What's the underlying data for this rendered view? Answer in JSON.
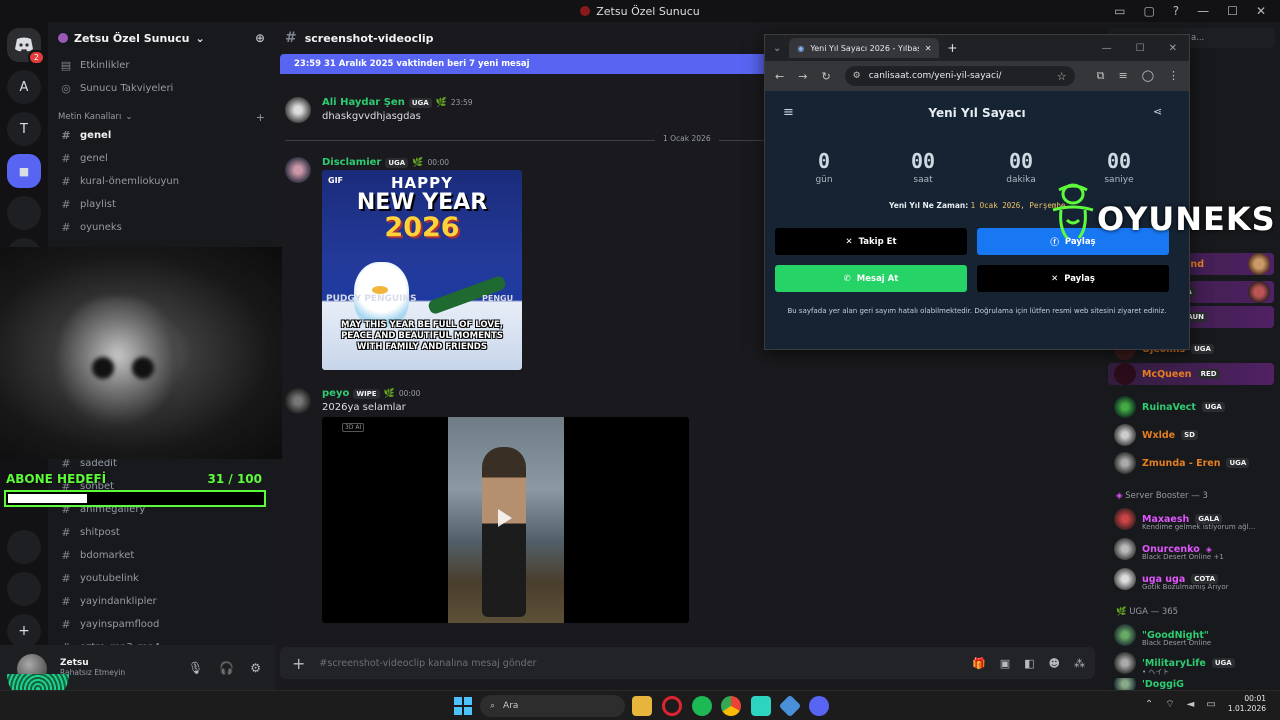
{
  "window": {
    "title": "Zetsu Özel Sunucu",
    "controls": [
      "▭",
      "▢",
      "?",
      "—",
      "☐",
      "✕"
    ]
  },
  "server": {
    "name": "Zetsu Özel Sunucu",
    "chevron": "⌄",
    "add_member_icon": "person-add-icon"
  },
  "rail": {
    "badge": "2",
    "letters": [
      "A",
      "T"
    ]
  },
  "sidebar": {
    "top_items": [
      {
        "label": "Etkinlikler",
        "icon": "▤"
      },
      {
        "label": "Sunucu Takviyeleri",
        "icon": "◎"
      }
    ],
    "category": "Metin Kanalları",
    "channels": [
      "genel",
      "genel",
      "kural-önemliokuyun",
      "playlist",
      "oyuneks"
    ],
    "lower_channels": [
      "sadedit",
      "sohbet",
      "animegallery",
      "shitpost",
      "bdomarket",
      "youtubelink",
      "yayindanklipler",
      "yayinspamflood",
      "oztro_mp3_mp4"
    ]
  },
  "overlay": {
    "goal_label": "ABONE HEDEFİ",
    "goal_current": 31,
    "goal_total": 100,
    "goal_sep": "/"
  },
  "user": {
    "name": "Zetsu",
    "status": "Rahatsız Etmeyin"
  },
  "chat": {
    "channel": "screenshot-videoclip",
    "new_messages": "23:59 31 Aralık 2025 vaktinden beri 7 yeni mesaj",
    "date_divider": "1 Ocak 2026",
    "messages": [
      {
        "user": "Ali Haydar Şen",
        "tag": "UGA",
        "time": "23:59",
        "text": "dhaskgvvdhjasgdas",
        "color": "#2ecc71"
      },
      {
        "user": "Disclamier",
        "tag": "UGA",
        "time": "00:00",
        "text": "",
        "color": "#2ecc71"
      },
      {
        "user": "peyo",
        "tag": "WIPE",
        "time": "00:00",
        "text": "2026ya selamlar",
        "color": "#2ecc71"
      }
    ],
    "gif": {
      "label": "GIF",
      "line1": "HAPPY",
      "line2": "NEW YEAR",
      "line3": "2026",
      "brand_left": "PUDGY PENGUINS",
      "brand_right": "PENGU",
      "caption": "MAY THIS YEAR BE FULL OF LOVE, PEACE AND BEAUTIFUL MOMENTS WITH FAMILY AND FRIENDS"
    },
    "video_tag": "3D AI",
    "composer_placeholder": "#screenshot-videoclip kanalına mesaj gönder"
  },
  "members": {
    "search_placeholder": "sunucusunu a...",
    "list": [
      {
        "name": "mond",
        "color": "#e67e22",
        "tag": "",
        "sub": ""
      },
      {
        "name": "",
        "color": "#9b59b6",
        "tag": "UGA",
        "sub": ""
      },
      {
        "name": "ga",
        "color": "#e67e22",
        "tag": "ZAUN",
        "sub": ""
      },
      {
        "name": "Ojeomis",
        "color": "#e67e22",
        "tag": "UGA",
        "sub": ""
      },
      {
        "name": "McQueen",
        "color": "#e67e22",
        "tag": "RED",
        "sub": ""
      },
      {
        "name": "RuinaVect",
        "color": "#2ecc71",
        "tag": "UGA",
        "sub": ""
      },
      {
        "name": "Wxlde",
        "color": "#e67e22",
        "tag": "SD",
        "sub": ""
      },
      {
        "name": "Zmunda - Eren",
        "color": "#e67e22",
        "tag": "UGA",
        "sub": ""
      }
    ],
    "booster_category": "Server Booster — 3",
    "boosters": [
      {
        "name": "Maxaesh",
        "color": "#e056fd",
        "tag": "GALA",
        "sub": "Kendime gelmek istiyorum ağl..."
      },
      {
        "name": "Onurcenko",
        "color": "#e056fd",
        "tag": "",
        "sub": "Black Desert Online +1"
      },
      {
        "name": "uga uga",
        "color": "#e056fd",
        "tag": "COTA",
        "sub": "Gotik Bozulmamış Arıyor"
      }
    ],
    "uga_category": "UGA — 365",
    "uga": [
      {
        "name": "\"GoodNight\"",
        "color": "#2ecc71",
        "tag": "",
        "sub": "Black Desert Online"
      },
      {
        "name": "'MilitaryLife",
        "color": "#2ecc71",
        "tag": "UGA",
        "sub": "• ヘイト"
      },
      {
        "name": "'DoggiG",
        "color": "#2ecc71",
        "tag": "",
        "sub": ""
      }
    ]
  },
  "browser": {
    "tab_title": "Yeni Yıl Sayacı 2026 - Yılbaşı Ge...",
    "url": "canlisaat.com/yeni-yil-sayaci/",
    "page_title": "Yeni Yıl Sayacı",
    "countdown": [
      {
        "value": "0",
        "unit": "gün"
      },
      {
        "value": "00",
        "unit": "saat"
      },
      {
        "value": "00",
        "unit": "dakika"
      },
      {
        "value": "00",
        "unit": "saniye"
      }
    ],
    "when_label": "Yeni Yıl Ne Zaman:",
    "when_value": "1 Ocak 2026, Perşembe",
    "buttons": {
      "follow": "Takip Et",
      "share_fb": "Paylaş",
      "whatsapp": "Mesaj At",
      "share_x": "Paylaş"
    },
    "disclaimer": "Bu sayfada yer alan geri sayım hatalı olabilmektedir. Doğrulama için lütfen resmi web sitesini ziyaret ediniz."
  },
  "watermark": {
    "text": "OYUNEKS"
  },
  "taskbar": {
    "search": "Ara",
    "time": "00:01",
    "date": "1.01.2026"
  }
}
